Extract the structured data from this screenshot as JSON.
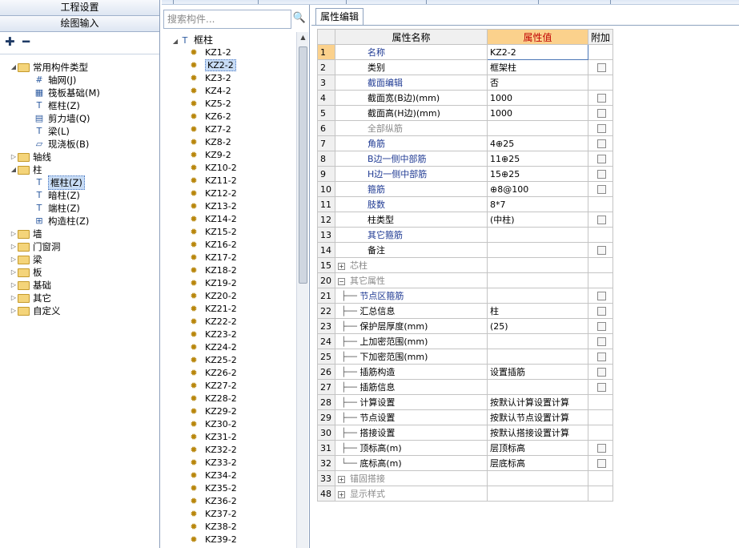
{
  "nav": {
    "header1": "工程设置",
    "header2": "绘图输入",
    "expand_all": "⁺₊",
    "collapse_all": "⁼",
    "tree": [
      {
        "label": "常用构件类型",
        "level": 0,
        "exp": "◢",
        "icon": "folder-icon"
      },
      {
        "label": "轴网(J)",
        "level": 1,
        "icon": "axis-grid-icon"
      },
      {
        "label": "筏板基础(M)",
        "level": 1,
        "icon": "raft-foundation-icon"
      },
      {
        "label": "框柱(Z)",
        "level": 1,
        "icon": "column-icon"
      },
      {
        "label": "剪力墙(Q)",
        "level": 1,
        "icon": "shear-wall-icon"
      },
      {
        "label": "梁(L)",
        "level": 1,
        "icon": "beam-icon"
      },
      {
        "label": "现浇板(B)",
        "level": 1,
        "icon": "slab-icon"
      },
      {
        "label": "轴线",
        "level": 0,
        "exp": "▷",
        "icon": "folder-icon"
      },
      {
        "label": "柱",
        "level": 0,
        "exp": "◢",
        "icon": "folder-icon"
      },
      {
        "label": "框柱(Z)",
        "level": 1,
        "icon": "column-icon",
        "selected": true
      },
      {
        "label": "暗柱(Z)",
        "level": 1,
        "icon": "hidden-column-icon"
      },
      {
        "label": "端柱(Z)",
        "level": 1,
        "icon": "end-column-icon"
      },
      {
        "label": "构造柱(Z)",
        "level": 1,
        "icon": "structural-column-icon"
      },
      {
        "label": "墙",
        "level": 0,
        "exp": "▷",
        "icon": "folder-icon"
      },
      {
        "label": "门窗洞",
        "level": 0,
        "exp": "▷",
        "icon": "folder-icon"
      },
      {
        "label": "梁",
        "level": 0,
        "exp": "▷",
        "icon": "folder-icon"
      },
      {
        "label": "板",
        "level": 0,
        "exp": "▷",
        "icon": "folder-icon"
      },
      {
        "label": "基础",
        "level": 0,
        "exp": "▷",
        "icon": "folder-icon"
      },
      {
        "label": "其它",
        "level": 0,
        "exp": "▷",
        "icon": "folder-icon"
      },
      {
        "label": "自定义",
        "level": 0,
        "exp": "▷",
        "icon": "folder-icon"
      }
    ]
  },
  "middle": {
    "search_placeholder": "搜索构件...",
    "search_icon": "search-icon",
    "root_label": "框柱",
    "root_exp": "◢",
    "items": [
      "KZ1-2",
      "KZ2-2",
      "KZ3-2",
      "KZ4-2",
      "KZ5-2",
      "KZ6-2",
      "KZ7-2",
      "KZ8-2",
      "KZ9-2",
      "KZ10-2",
      "KZ11-2",
      "KZ12-2",
      "KZ13-2",
      "KZ14-2",
      "KZ15-2",
      "KZ16-2",
      "KZ17-2",
      "KZ18-2",
      "KZ19-2",
      "KZ20-2",
      "KZ21-2",
      "KZ22-2",
      "KZ23-2",
      "KZ24-2",
      "KZ25-2",
      "KZ26-2",
      "KZ27-2",
      "KZ28-2",
      "KZ29-2",
      "KZ30-2",
      "KZ31-2",
      "KZ32-2",
      "KZ33-2",
      "KZ34-2",
      "KZ35-2",
      "KZ36-2",
      "KZ37-2",
      "KZ38-2",
      "KZ39-2"
    ],
    "selected_index": 1
  },
  "props": {
    "tab_label": "属性编辑",
    "col_name": "属性名称",
    "col_value": "属性值",
    "col_extra": "附加",
    "rows": [
      {
        "num": "1",
        "name": "名称",
        "value": "KZ2-2",
        "style": "blue",
        "cb": false,
        "active": true
      },
      {
        "num": "2",
        "name": "类别",
        "value": "框架柱",
        "style": "",
        "cb": true
      },
      {
        "num": "3",
        "name": "截面编辑",
        "value": "否",
        "style": "blue",
        "cb": false
      },
      {
        "num": "4",
        "name": "截面宽(B边)(mm)",
        "value": "1000",
        "style": "",
        "cb": true
      },
      {
        "num": "5",
        "name": "截面高(H边)(mm)",
        "value": "1000",
        "style": "",
        "cb": true
      },
      {
        "num": "6",
        "name": "全部纵筋",
        "value": "",
        "style": "gray",
        "cb": true
      },
      {
        "num": "7",
        "name": "角筋",
        "value": "4⊕25",
        "style": "blue",
        "cb": true
      },
      {
        "num": "8",
        "name": "B边一侧中部筋",
        "value": "11⊕25",
        "style": "blue",
        "cb": true
      },
      {
        "num": "9",
        "name": "H边一侧中部筋",
        "value": "15⊕25",
        "style": "blue",
        "cb": true
      },
      {
        "num": "10",
        "name": "箍筋",
        "value": "⊕8@100",
        "style": "blue",
        "cb": true
      },
      {
        "num": "11",
        "name": "肢数",
        "value": "8*7",
        "style": "blue",
        "cb": false
      },
      {
        "num": "12",
        "name": "柱类型",
        "value": "(中柱)",
        "style": "",
        "cb": true
      },
      {
        "num": "13",
        "name": "其它箍筋",
        "value": "",
        "style": "blue",
        "cb": false
      },
      {
        "num": "14",
        "name": "备注",
        "value": "",
        "style": "",
        "cb": true
      },
      {
        "num": "15",
        "name": "芯柱",
        "value": "",
        "style": "gray",
        "cb": false,
        "pm": "+"
      },
      {
        "num": "20",
        "name": "其它属性",
        "value": "",
        "style": "gray",
        "cb": false,
        "pm": "−"
      },
      {
        "num": "21",
        "name": "节点区箍筋",
        "value": "",
        "style": "blue",
        "cb": true,
        "child": true
      },
      {
        "num": "22",
        "name": "汇总信息",
        "value": "柱",
        "style": "",
        "cb": true,
        "child": true
      },
      {
        "num": "23",
        "name": "保护层厚度(mm)",
        "value": "(25)",
        "style": "",
        "cb": true,
        "child": true
      },
      {
        "num": "24",
        "name": "上加密范围(mm)",
        "value": "",
        "style": "",
        "cb": true,
        "child": true
      },
      {
        "num": "25",
        "name": "下加密范围(mm)",
        "value": "",
        "style": "",
        "cb": true,
        "child": true
      },
      {
        "num": "26",
        "name": "插筋构造",
        "value": "设置插筋",
        "style": "",
        "cb": true,
        "child": true
      },
      {
        "num": "27",
        "name": "插筋信息",
        "value": "",
        "style": "",
        "cb": true,
        "child": true
      },
      {
        "num": "28",
        "name": "计算设置",
        "value": "按默认计算设置计算",
        "style": "",
        "cb": false,
        "child": true
      },
      {
        "num": "29",
        "name": "节点设置",
        "value": "按默认节点设置计算",
        "style": "",
        "cb": false,
        "child": true
      },
      {
        "num": "30",
        "name": "搭接设置",
        "value": "按默认搭接设置计算",
        "style": "",
        "cb": false,
        "child": true
      },
      {
        "num": "31",
        "name": "顶标高(m)",
        "value": "层顶标高",
        "style": "",
        "cb": true,
        "child": true
      },
      {
        "num": "32",
        "name": "底标高(m)",
        "value": "层底标高",
        "style": "",
        "cb": true,
        "child": true,
        "last": true
      },
      {
        "num": "33",
        "name": "锚固搭接",
        "value": "",
        "style": "gray",
        "cb": false,
        "pm": "+"
      },
      {
        "num": "48",
        "name": "显示样式",
        "value": "",
        "style": "gray",
        "cb": false,
        "pm": "+"
      }
    ]
  }
}
